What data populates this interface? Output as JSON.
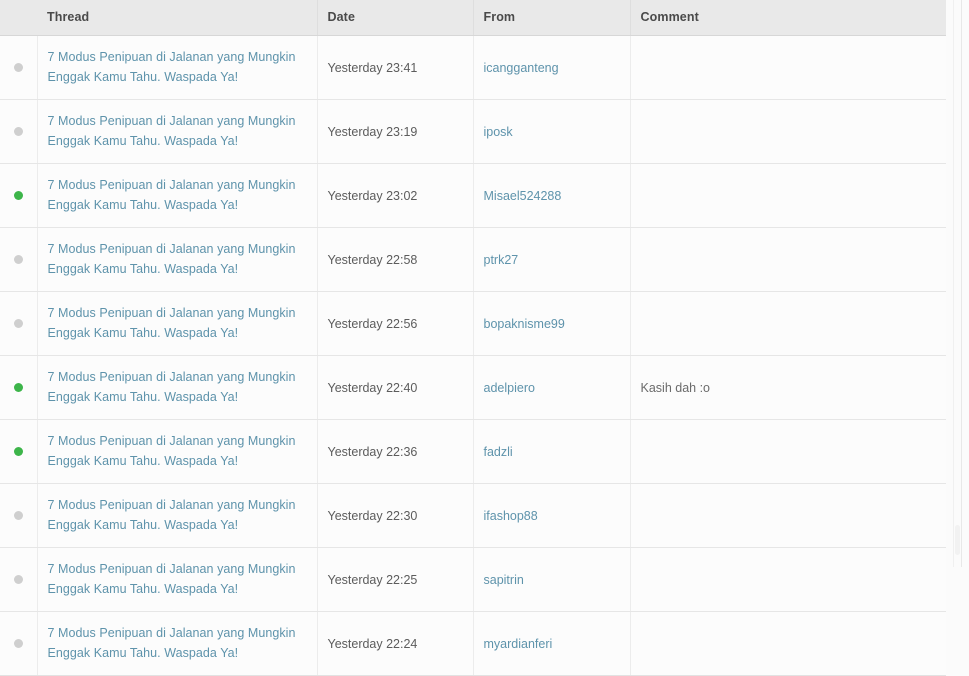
{
  "table": {
    "columns": [
      {
        "key": "flag",
        "label": ""
      },
      {
        "key": "thread",
        "label": "Thread"
      },
      {
        "key": "date",
        "label": "Date"
      },
      {
        "key": "from",
        "label": "From"
      },
      {
        "key": "comment",
        "label": "Comment"
      }
    ],
    "rows": [
      {
        "status": "read",
        "thread": "7 Modus Penipuan di Jalanan yang Mungkin Enggak Kamu Tahu. Waspada Ya!",
        "date": "Yesterday 23:41",
        "from": "icangganteng",
        "comment": ""
      },
      {
        "status": "read",
        "thread": "7 Modus Penipuan di Jalanan yang Mungkin Enggak Kamu Tahu. Waspada Ya!",
        "date": "Yesterday 23:19",
        "from": "iposk",
        "comment": ""
      },
      {
        "status": "unread",
        "thread": "7 Modus Penipuan di Jalanan yang Mungkin Enggak Kamu Tahu. Waspada Ya!",
        "date": "Yesterday 23:02",
        "from": "Misael524288",
        "comment": ""
      },
      {
        "status": "read",
        "thread": "7 Modus Penipuan di Jalanan yang Mungkin Enggak Kamu Tahu. Waspada Ya!",
        "date": "Yesterday 22:58",
        "from": "ptrk27",
        "comment": ""
      },
      {
        "status": "read",
        "thread": "7 Modus Penipuan di Jalanan yang Mungkin Enggak Kamu Tahu. Waspada Ya!",
        "date": "Yesterday 22:56",
        "from": "bopaknisme99",
        "comment": ""
      },
      {
        "status": "unread",
        "thread": "7 Modus Penipuan di Jalanan yang Mungkin Enggak Kamu Tahu. Waspada Ya!",
        "date": "Yesterday 22:40",
        "from": "adelpiero",
        "comment": "Kasih dah :o"
      },
      {
        "status": "unread",
        "thread": "7 Modus Penipuan di Jalanan yang Mungkin Enggak Kamu Tahu. Waspada Ya!",
        "date": "Yesterday 22:36",
        "from": "fadzli",
        "comment": ""
      },
      {
        "status": "read",
        "thread": "7 Modus Penipuan di Jalanan yang Mungkin Enggak Kamu Tahu. Waspada Ya!",
        "date": "Yesterday 22:30",
        "from": "ifashop88",
        "comment": ""
      },
      {
        "status": "read",
        "thread": "7 Modus Penipuan di Jalanan yang Mungkin Enggak Kamu Tahu. Waspada Ya!",
        "date": "Yesterday 22:25",
        "from": "sapitrin",
        "comment": ""
      },
      {
        "status": "read",
        "thread": "7 Modus Penipuan di Jalanan yang Mungkin Enggak Kamu Tahu. Waspada Ya!",
        "date": "Yesterday 22:24",
        "from": "myardianferi",
        "comment": ""
      }
    ]
  },
  "colors": {
    "link": "#5e93ab",
    "header_bg": "#e9e9e9",
    "unread_dot": "#3db54a",
    "read_dot": "#cfcfcf",
    "row_bg": "#fcfcfc"
  }
}
